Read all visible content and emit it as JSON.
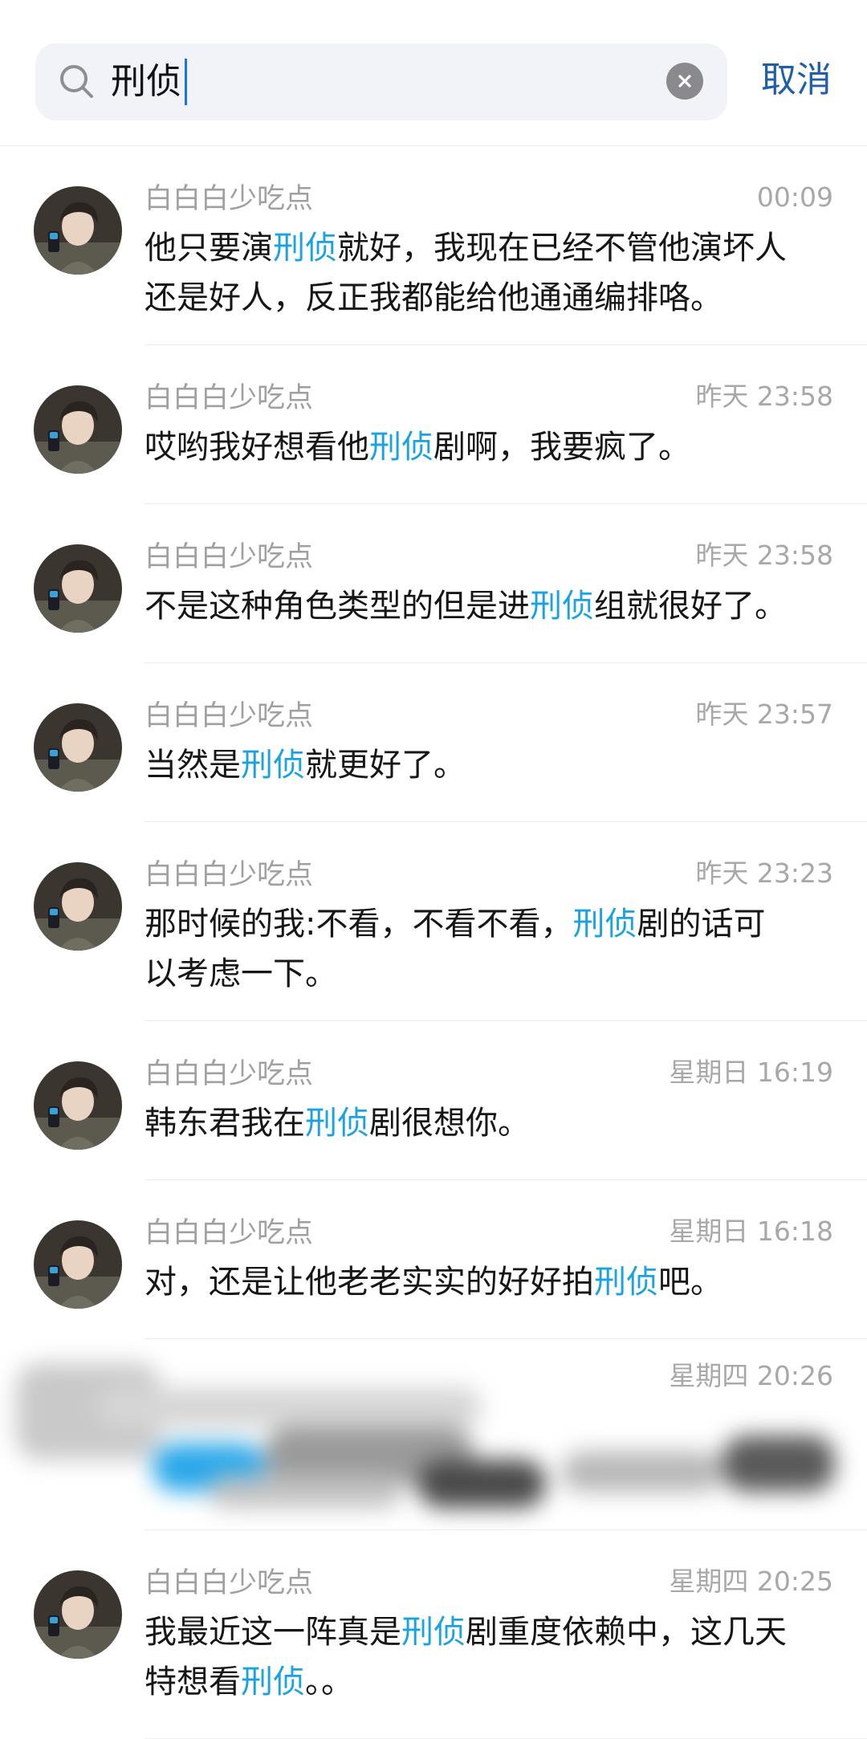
{
  "search": {
    "query": "刑侦",
    "cancel_label": "取消"
  },
  "results": [
    {
      "name": "白白白少吃点",
      "time": "00:09",
      "lines": [
        [
          [
            "他只要演",
            false
          ],
          [
            "刑侦",
            true
          ],
          [
            "就好，我现在已经不管他演坏人",
            false
          ]
        ],
        [
          [
            "还是好人，反正我都能给他通通编排咯。",
            false
          ]
        ]
      ]
    },
    {
      "name": "白白白少吃点",
      "time": "昨天 23:58",
      "lines": [
        [
          [
            "哎哟我好想看他",
            false
          ],
          [
            "刑侦",
            true
          ],
          [
            "剧啊，我要疯了。",
            false
          ]
        ]
      ]
    },
    {
      "name": "白白白少吃点",
      "time": "昨天 23:58",
      "lines": [
        [
          [
            "不是这种角色类型的但是进",
            false
          ],
          [
            "刑侦",
            true
          ],
          [
            "组就很好了。",
            false
          ]
        ]
      ]
    },
    {
      "name": "白白白少吃点",
      "time": "昨天 23:57",
      "lines": [
        [
          [
            "当然是",
            false
          ],
          [
            "刑侦",
            true
          ],
          [
            "就更好了。",
            false
          ]
        ]
      ]
    },
    {
      "name": "白白白少吃点",
      "time": "昨天 23:23",
      "lines": [
        [
          [
            "那时候的我:不看，不看不看，",
            false
          ],
          [
            "刑侦",
            true
          ],
          [
            "剧的话可",
            false
          ]
        ],
        [
          [
            "以考虑一下。",
            false
          ]
        ]
      ]
    },
    {
      "name": "白白白少吃点",
      "time": "星期日 16:19",
      "lines": [
        [
          [
            "韩东君我在",
            false
          ],
          [
            "刑侦",
            true
          ],
          [
            "剧很想你。",
            false
          ]
        ]
      ]
    },
    {
      "name": "白白白少吃点",
      "time": "星期日 16:18",
      "lines": [
        [
          [
            "对，还是让他老老实实的好好拍",
            false
          ],
          [
            "刑侦",
            true
          ],
          [
            "吧。",
            false
          ]
        ]
      ]
    }
  ],
  "blurred_result": {
    "time": "星期四 20:26"
  },
  "last_result": {
    "name": "白白白少吃点",
    "time": "星期四 20:25",
    "lines": [
      [
        [
          "我最近这一阵真是",
          false
        ],
        [
          "刑侦",
          true
        ],
        [
          "剧重度依赖中，这几天",
          false
        ]
      ],
      [
        [
          "特想看",
          false
        ],
        [
          "刑侦",
          true
        ],
        [
          "。。",
          false
        ]
      ]
    ]
  },
  "icons": {
    "search": "search-icon",
    "clear": "clear-icon",
    "avatar": "avatar"
  },
  "colors": {
    "highlight": "#1aa3e0",
    "cancel": "#1f5fa8",
    "search_bg": "#f1f3f8"
  }
}
